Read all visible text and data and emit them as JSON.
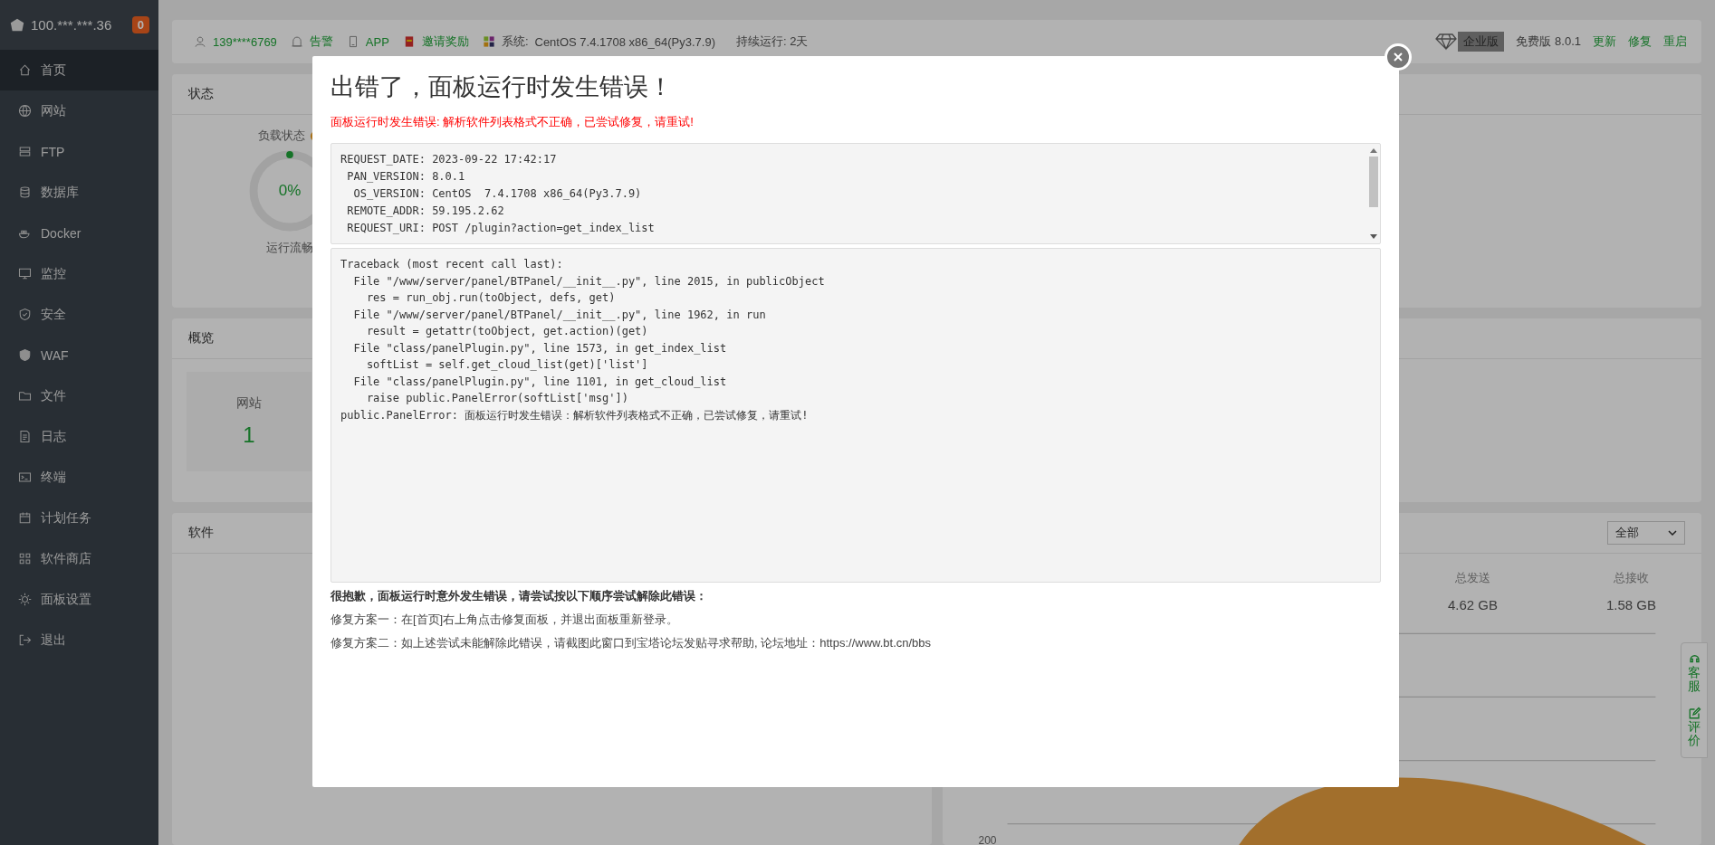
{
  "sidebar": {
    "host": "100.***.***.36",
    "badge": "0",
    "items": [
      {
        "label": "首页",
        "selected": true
      },
      {
        "label": "网站",
        "selected": false
      },
      {
        "label": "FTP",
        "selected": false
      },
      {
        "label": "数据库",
        "selected": false
      },
      {
        "label": "Docker",
        "selected": false
      },
      {
        "label": "监控",
        "selected": false
      },
      {
        "label": "安全",
        "selected": false
      },
      {
        "label": "WAF",
        "selected": false
      },
      {
        "label": "文件",
        "selected": false
      },
      {
        "label": "日志",
        "selected": false
      },
      {
        "label": "终端",
        "selected": false
      },
      {
        "label": "计划任务",
        "selected": false
      },
      {
        "label": "软件商店",
        "selected": false
      },
      {
        "label": "面板设置",
        "selected": false
      },
      {
        "label": "退出",
        "selected": false
      }
    ]
  },
  "top_bar": {
    "user": "139****6769",
    "alert": "告警",
    "app": "APP",
    "invite": "邀请奖励",
    "system_label": "系统:",
    "system": "CentOS 7.4.1708 x86_64(Py3.7.9)",
    "uptime": "持续运行: 2天",
    "edition": "企业版",
    "version": "免费版 8.0.1",
    "links": [
      "更新",
      "修复",
      "重启"
    ]
  },
  "status_panel": {
    "title": "状态",
    "gauge": {
      "label": "负载状态",
      "value": "0%",
      "status": "运行流畅",
      "level": 0
    }
  },
  "overview_panel": {
    "title": "概览",
    "cards": [
      {
        "label": "网站",
        "count": "1"
      }
    ]
  },
  "software_panel": {
    "title": "软件"
  },
  "traffic_panel": {
    "filter": "全部",
    "stats": [
      {
        "label": "总发送",
        "value": "4.62 GB"
      },
      {
        "label": "总接收",
        "value": "1.58 GB"
      }
    ],
    "tick": "200"
  },
  "float_tab": [
    {
      "label": "客服"
    },
    {
      "label": "评价"
    }
  ],
  "dialog": {
    "title": "出错了，面板运行时发生错误！",
    "error": "面板运行时发生错误: 解析软件列表格式不正确，已尝试修复，请重试!",
    "request_lines": [
      "REQUEST_DATE: 2023-09-22 17:42:17",
      " PAN_VERSION: 8.0.1",
      "  OS_VERSION: CentOS  7.4.1708 x86_64(Py3.7.9)",
      " REMOTE_ADDR: 59.195.2.62",
      " REQUEST_URI: POST /plugin?action=get_index_list"
    ],
    "traceback_lines": [
      "Traceback (most recent call last):",
      "  File \"/www/server/panel/BTPanel/__init__.py\", line 2015, in publicObject",
      "    res = run_obj.run(toObject, defs, get)",
      "  File \"/www/server/panel/BTPanel/__init__.py\", line 1962, in run",
      "    result = getattr(toObject, get.action)(get)",
      "  File \"class/panelPlugin.py\", line 1573, in get_index_list",
      "    softList = self.get_cloud_list(get)['list']",
      "  File \"class/panelPlugin.py\", line 1101, in get_cloud_list",
      "    raise public.PanelError(softList['msg'])",
      "public.PanelError: 面板运行时发生错误：解析软件列表格式不正确，已尝试修复，请重试!"
    ],
    "help_title": "很抱歉，面板运行时意外发生错误，请尝试按以下顺序尝试解除此错误：",
    "help_lines": [
      "修复方案一：在[首页]右上角点击修复面板，并退出面板重新登录。",
      "修复方案二：如上述尝试未能解除此错误，请截图此窗口到宝塔论坛发贴寻求帮助, 论坛地址：https://www.bt.cn/bbs"
    ]
  }
}
